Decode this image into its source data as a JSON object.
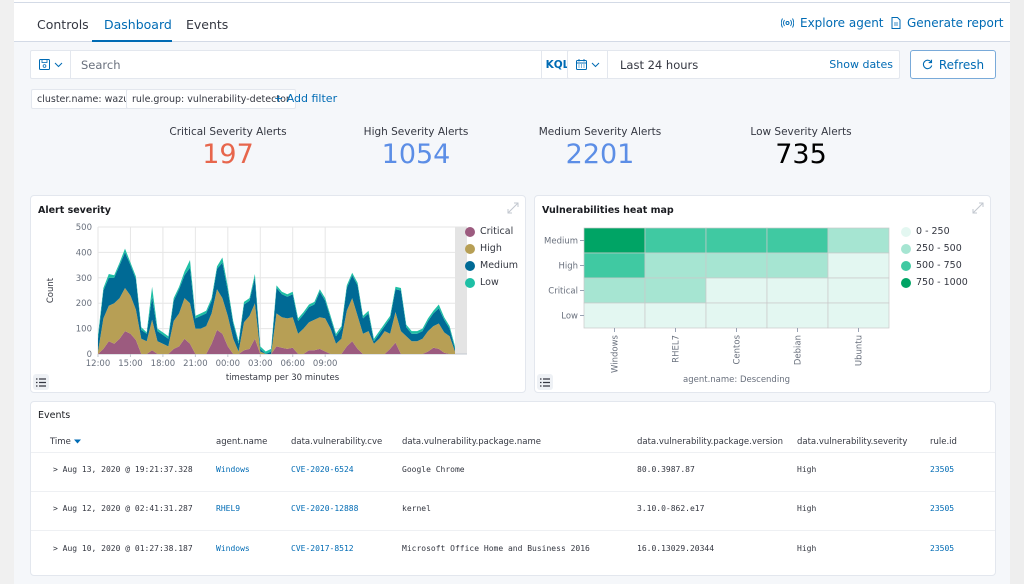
{
  "tabs": [
    {
      "label": "Controls",
      "active": false
    },
    {
      "label": "Dashboard",
      "active": true
    },
    {
      "label": "Events",
      "active": false
    }
  ],
  "header_actions": {
    "explore_agent": "Explore agent",
    "generate_report": "Generate report"
  },
  "search": {
    "placeholder": "Search",
    "value": "",
    "language": "KQL"
  },
  "date_picker": {
    "range": "Last 24 hours",
    "show_dates": "Show dates"
  },
  "refresh_label": "Refresh",
  "filters": [
    "cluster.name: wazuh",
    "rule.group: vulnerability-detector"
  ],
  "add_filter_label": "+ Add filter",
  "metrics": [
    {
      "label": "Critical Severity Alerts",
      "value": "197",
      "color": "#e7664c"
    },
    {
      "label": "High Severity Alerts",
      "value": "1054",
      "color": "#5c8ee6"
    },
    {
      "label": "Medium Severity Alerts",
      "value": "2201",
      "color": "#5c8ee6"
    },
    {
      "label": "Low Severity Alerts",
      "value": "735",
      "color": "#000000"
    }
  ],
  "chart_data": [
    {
      "type": "area",
      "stacked": true,
      "title": "Alert severity",
      "xlabel": "timestamp per 30 minutes",
      "ylabel": "Count",
      "ylim": [
        0,
        500
      ],
      "yticks": [
        0,
        100,
        200,
        300,
        400,
        500
      ],
      "xticks": [
        "15:00",
        "18:00",
        "21:00",
        "00:00",
        "03:00",
        "06:00",
        "09:00",
        "12:00"
      ],
      "x_start": "12:00",
      "x_step_minutes": 30,
      "grid": true,
      "legend_position": "right",
      "series": [
        {
          "name": "Critical",
          "color": "#9c5b7f",
          "values": [
            0,
            20,
            50,
            40,
            60,
            90,
            80,
            55,
            0,
            0,
            15,
            0,
            0,
            0,
            20,
            30,
            60,
            40,
            0,
            0,
            0,
            40,
            95,
            80,
            30,
            0,
            0,
            15,
            20,
            60,
            0,
            0,
            0,
            30,
            25,
            20,
            25,
            0,
            0,
            15,
            15,
            20,
            10,
            0,
            0,
            0,
            30,
            50,
            20,
            0,
            0,
            0,
            0,
            0,
            20,
            45,
            0,
            0,
            0,
            0,
            0,
            10,
            25,
            20,
            5,
            0,
            0
          ]
        },
        {
          "name": "High",
          "color": "#b79f55",
          "values": [
            10,
            120,
            140,
            160,
            160,
            170,
            150,
            120,
            60,
            50,
            120,
            50,
            40,
            30,
            110,
            130,
            160,
            160,
            100,
            100,
            110,
            120,
            160,
            140,
            120,
            60,
            10,
            110,
            130,
            140,
            10,
            0,
            0,
            130,
            120,
            120,
            120,
            80,
            100,
            110,
            120,
            125,
            130,
            100,
            40,
            60,
            140,
            170,
            130,
            80,
            90,
            40,
            60,
            90,
            60,
            120,
            90,
            70,
            50,
            50,
            60,
            80,
            85,
            100,
            80,
            70,
            10
          ]
        },
        {
          "name": "Medium",
          "color": "#006a95",
          "values": [
            50,
            110,
            110,
            100,
            130,
            140,
            120,
            120,
            35,
            30,
            90,
            40,
            35,
            30,
            80,
            95,
            90,
            140,
            40,
            50,
            50,
            50,
            80,
            140,
            100,
            60,
            30,
            70,
            60,
            100,
            10,
            0,
            10,
            100,
            90,
            85,
            90,
            50,
            55,
            60,
            60,
            100,
            70,
            40,
            30,
            40,
            90,
            90,
            120,
            60,
            70,
            10,
            20,
            20,
            60,
            90,
            160,
            35,
            30,
            30,
            30,
            40,
            50,
            60,
            50,
            30,
            10
          ]
        },
        {
          "name": "Low",
          "color": "#1ebfa5",
          "values": [
            15,
            10,
            15,
            10,
            10,
            15,
            10,
            10,
            10,
            5,
            40,
            10,
            10,
            10,
            10,
            10,
            15,
            30,
            10,
            10,
            10,
            10,
            10,
            20,
            15,
            10,
            10,
            10,
            10,
            15,
            10,
            10,
            10,
            10,
            10,
            10,
            10,
            10,
            10,
            10,
            10,
            10,
            10,
            10,
            10,
            10,
            10,
            10,
            10,
            10,
            10,
            10,
            10,
            10,
            10,
            10,
            10,
            10,
            10,
            10,
            10,
            10,
            10,
            15,
            10,
            10,
            10
          ]
        }
      ]
    },
    {
      "type": "heatmap",
      "title": "Vulnerabilities heat map",
      "xlabel": "agent.name: Descending",
      "x_categories": [
        "Windows",
        "RHEL7",
        "Centos",
        "Debian",
        "Ubuntu"
      ],
      "y_categories": [
        "Medium",
        "High",
        "Critical",
        "Low"
      ],
      "legend_position": "right",
      "legend": [
        {
          "label": "0 - 250",
          "color": "#e3f7f1"
        },
        {
          "label": "250 - 500",
          "color": "#a6e5d2"
        },
        {
          "label": "500 - 750",
          "color": "#40c9a2"
        },
        {
          "label": "750 - 1000",
          "color": "#00a465"
        }
      ],
      "bucket_index": [
        [
          3,
          2,
          2,
          2,
          1
        ],
        [
          2,
          1,
          1,
          1,
          0
        ],
        [
          1,
          1,
          0,
          0,
          0
        ],
        [
          0,
          0,
          0,
          0,
          0
        ]
      ]
    }
  ],
  "events": {
    "title": "Events",
    "columns": [
      "Time",
      "agent.name",
      "data.vulnerability.cve",
      "data.vulnerability.package.name",
      "data.vulnerability.package.version",
      "data.vulnerability.severity",
      "rule.id"
    ],
    "sort_column": "Time",
    "rows": [
      {
        "time": "> Aug 13, 2020 @ 19:21:37.328",
        "agent": "Windows",
        "cve": "CVE-2020-6524",
        "package": "Google Chrome",
        "version": "80.0.3987.87",
        "severity": "High",
        "rule_id": "23505"
      },
      {
        "time": "> Aug 12, 2020 @ 02:41:31.287",
        "agent": "RHEL9",
        "cve": "CVE-2020-12888",
        "package": "kernel",
        "version": "3.10.0-862.e17",
        "severity": "High",
        "rule_id": "23505"
      },
      {
        "time": "> Aug 10, 2020 @ 01:27:38.187",
        "agent": "Windows",
        "cve": "CVE-2017-8512",
        "package": "Microsoft Office Home and Business 2016",
        "version": "16.0.13029.20344",
        "severity": "High",
        "rule_id": "23505"
      }
    ]
  }
}
